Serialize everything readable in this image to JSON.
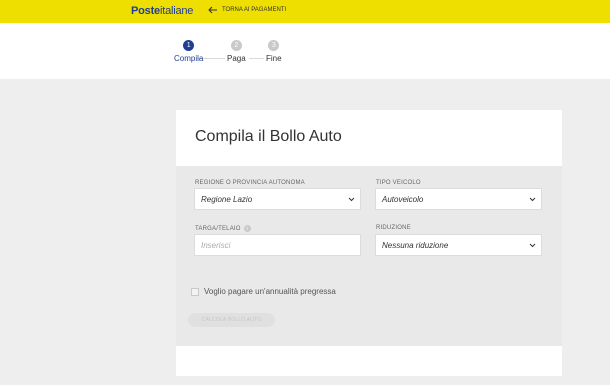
{
  "header": {
    "logo_bold": "Poste",
    "logo_regular": "italiane",
    "back_label": "TORNA AI PAGAMENTI",
    "back_icon": "arrow-left-icon",
    "background_color": "#eedf00",
    "brand_color": "#1f3f95"
  },
  "steps": [
    {
      "number": "1",
      "label": "Compila",
      "state": "active"
    },
    {
      "number": "2",
      "label": "Paga",
      "state": "inactive"
    },
    {
      "number": "3",
      "label": "Fine",
      "state": "inactive"
    }
  ],
  "form": {
    "title": "Compila il Bollo Auto",
    "regione": {
      "label": "REGIONE O PROVINCIA AUTONOMA",
      "value": "Regione Lazio"
    },
    "tipo_veicolo": {
      "label": "TIPO VEICOLO",
      "value": "Autoveicolo"
    },
    "targa": {
      "label": "TARGA/TELAIO",
      "placeholder": "Inserisci",
      "info_icon": "info-icon"
    },
    "riduzione": {
      "label": "RIDUZIONE",
      "value": "Nessuna riduzione"
    },
    "annualita_checkbox": {
      "label": "Voglio pagare un'annualità pregressa",
      "checked": false
    },
    "submit_label": "CALCOLA BOLLO AUTO"
  }
}
